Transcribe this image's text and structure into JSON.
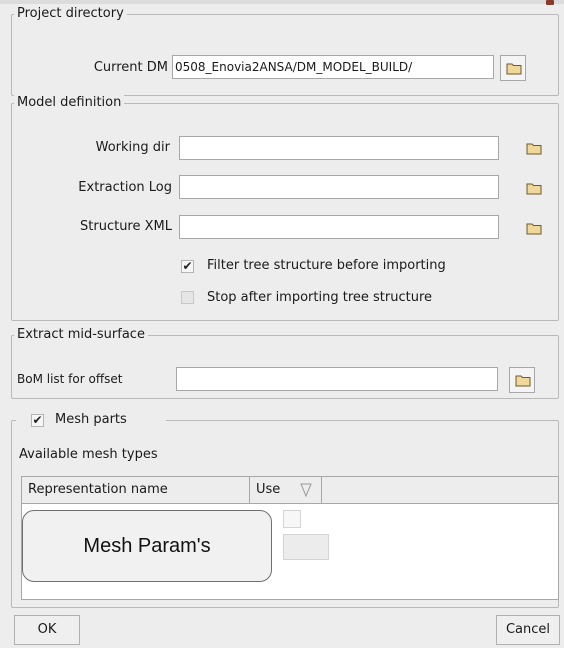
{
  "project_directory": {
    "legend": "Project directory",
    "current_dm_label": "Current DM",
    "current_dm_value": "0508_Enovia2ANSA/DM_MODEL_BUILD/"
  },
  "model_definition": {
    "legend": "Model definition",
    "working_dir_label": "Working dir",
    "working_dir_value": "",
    "extraction_log_label": "Extraction Log",
    "extraction_log_value": "",
    "structure_xml_label": "Structure XML",
    "structure_xml_value": "",
    "filter_tree_label": "Filter tree structure before importing",
    "filter_tree_checked": true,
    "stop_after_label": "Stop after importing tree structure",
    "stop_after_checked": false
  },
  "extract_mid_surface": {
    "legend": "Extract mid-surface",
    "bom_label": "BoM list for offset",
    "bom_value": ""
  },
  "mesh_parts": {
    "legend": "Mesh parts",
    "checked": true,
    "available_label": "Available mesh types",
    "columns": [
      "Representation name",
      "Use"
    ],
    "callout": "Mesh Param's"
  },
  "footer": {
    "ok_label": "OK",
    "cancel_label": "Cancel"
  },
  "icons": {
    "folder": "folder-icon",
    "sort": "sort-triangle-icon",
    "check": "checkmark-icon"
  },
  "colors": {
    "background": "#ededed",
    "folder_fill": "#f0d79a",
    "folder_stroke": "#6b5a2c"
  }
}
